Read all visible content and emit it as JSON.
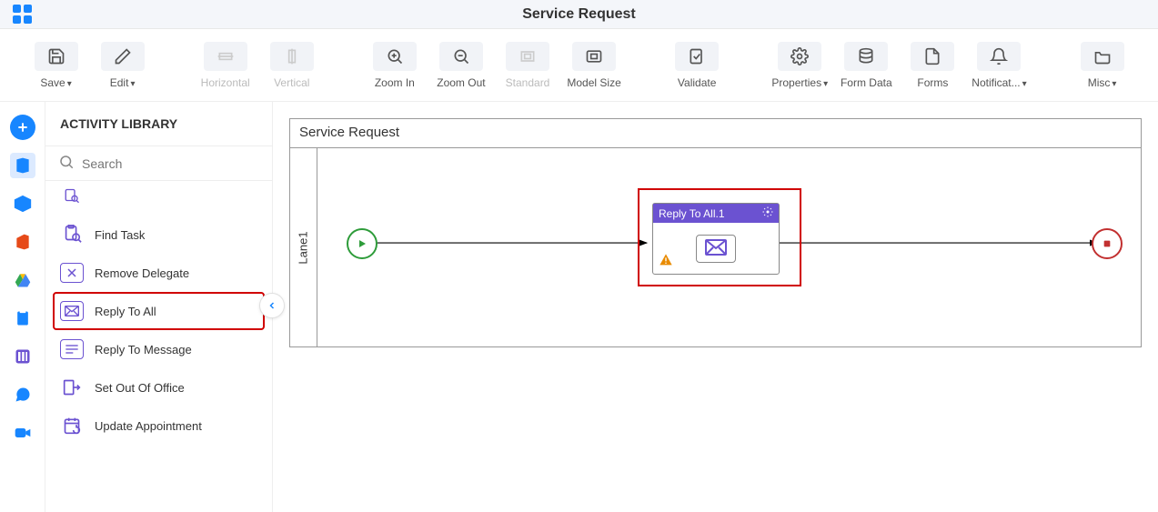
{
  "header": {
    "title": "Service Request"
  },
  "toolbar": {
    "save": "Save",
    "edit": "Edit",
    "horizontal": "Horizontal",
    "vertical": "Vertical",
    "zoom_in": "Zoom In",
    "zoom_out": "Zoom Out",
    "standard": "Standard",
    "model_size": "Model Size",
    "validate": "Validate",
    "properties": "Properties",
    "form_data": "Form Data",
    "forms": "Forms",
    "notifications": "Notificat...",
    "misc": "Misc"
  },
  "sidebar": {
    "title": "ACTIVITY LIBRARY",
    "search_placeholder": "Search",
    "items": {
      "find_task": "Find Task",
      "remove_delegate": "Remove Delegate",
      "reply_to_all": "Reply To All",
      "reply_to_message": "Reply To Message",
      "set_out_of_office": "Set Out Of Office",
      "update_appointment": "Update Appointment"
    }
  },
  "canvas": {
    "process_title": "Service Request",
    "lane_label": "Lane1",
    "activity_label": "Reply To All.1"
  }
}
